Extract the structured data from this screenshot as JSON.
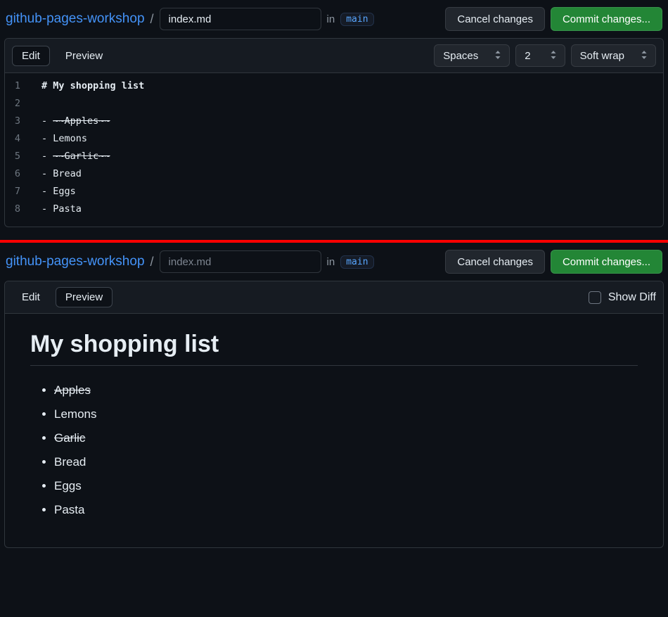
{
  "top": {
    "repo": "github-pages-workshop",
    "filename": "index.md",
    "filename_placeholder": "index.md",
    "in_label": "in",
    "branch": "main",
    "cancel": "Cancel changes",
    "commit": "Commit changes..."
  },
  "tabs": {
    "edit": "Edit",
    "preview": "Preview"
  },
  "toolbar": {
    "indent": "Spaces",
    "indent_size": "2",
    "wrap": "Soft wrap"
  },
  "preview_toolbar": {
    "show_diff": "Show Diff"
  },
  "code": {
    "lines": [
      {
        "n": "1",
        "prefix": "# ",
        "text": "My shopping list",
        "bold": true
      },
      {
        "n": "2",
        "prefix": "",
        "text": ""
      },
      {
        "n": "3",
        "prefix": "- ",
        "tilde": "~~",
        "text": "Apples",
        "strike": true
      },
      {
        "n": "4",
        "prefix": "- ",
        "text": "Lemons"
      },
      {
        "n": "5",
        "prefix": "- ",
        "tilde": "~~",
        "text": "Garlic",
        "strike": true
      },
      {
        "n": "6",
        "prefix": "- ",
        "text": "Bread"
      },
      {
        "n": "7",
        "prefix": "- ",
        "text": "Eggs"
      },
      {
        "n": "8",
        "prefix": "- ",
        "text": "Pasta"
      }
    ]
  },
  "preview": {
    "heading": "My shopping list",
    "items": [
      {
        "text": "Apples",
        "strike": true
      },
      {
        "text": "Lemons"
      },
      {
        "text": "Garlic",
        "strike": true
      },
      {
        "text": "Bread"
      },
      {
        "text": "Eggs"
      },
      {
        "text": "Pasta"
      }
    ]
  }
}
